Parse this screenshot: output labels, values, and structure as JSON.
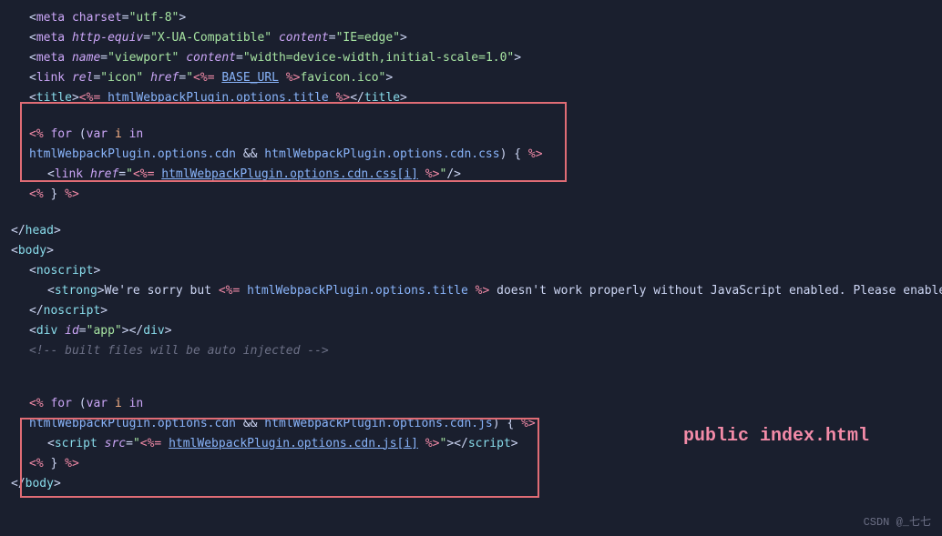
{
  "annotation": "public index.html",
  "watermark": "CSDN @_七七",
  "lines": [
    {
      "indent": 1,
      "content": "<code><span class='punct'>&lt;</span><span class='attr-name'>meta</span> <span class='attr-name'>charset</span><span class='punct'>=</span><span class='attr-val'>\"utf-8\"</span><span class='punct'>&gt;</span></code>"
    },
    {
      "indent": 1,
      "content": "<code><span class='punct'>&lt;</span><span class='attr-name'>meta</span> <span class='attr-name' style='font-style:italic'>http-equiv</span><span class='punct'>=</span><span class='attr-val'>\"X-UA-Compatible\"</span> <span class='attr-name' style='font-style:italic'>content</span><span class='punct'>=</span><span class='attr-val'>\"IE=edge\"</span><span class='punct'>&gt;</span></code>"
    },
    {
      "indent": 1,
      "content": "<code><span class='punct'>&lt;</span><span class='attr-name'>meta</span> <span class='attr-name' style='font-style:italic'>name</span><span class='punct'>=</span><span class='attr-val'>\"viewport\"</span> <span class='attr-name' style='font-style:italic'>content</span><span class='punct'>=</span><span class='attr-val'>\"width=device-width,initial-scale=1.0\"</span><span class='punct'>&gt;</span></code>"
    },
    {
      "indent": 1,
      "content": "<code><span class='punct'>&lt;</span><span class='attr-name'>link</span> <span class='attr-name' style='font-style:italic'>rel</span><span class='punct'>=</span><span class='attr-val'>\"icon\"</span> <span class='attr-name' style='font-style:italic'>href</span><span class='punct'>=</span><span class='attr-val'>\"</span><span class='tmpl-tag'>&lt;%=</span> <span class='url-link'>BASE_URL</span> <span class='tmpl-tag'>%&gt;</span><span class='attr-val'>favicon.ico\"</span><span class='punct'>&gt;</span></code>"
    },
    {
      "indent": 1,
      "content": "<code><span class='punct'>&lt;</span><span class='tag'>title</span><span class='punct'>&gt;</span><span class='tmpl-tag'>&lt;%=</span> <span class='tmpl-var'>htmlWebpackPlugin.options.title</span> <span class='tmpl-tag'>%&gt;</span><span class='punct'>&lt;/</span><span class='tag'>title</span><span class='punct'>&gt;</span></code>"
    },
    {
      "gap": true
    },
    {
      "indent": 1,
      "box": "css",
      "content": "<code><span class='tmpl-tag'>&lt;%</span> <span class='keyword'>for</span> <span class='white'>(</span><span class='keyword'>var</span> <span class='js-var'>i</span> <span class='keyword'>in</span></code>"
    },
    {
      "indent": 1,
      "box": "css",
      "content": "<code><span class='tmpl-var'>htmlWebpackPlugin.options.cdn</span> <span class='white'>&amp;&amp;</span> <span class='tmpl-var'>htmlWebpackPlugin.options.cdn.css</span><span class='white'>)</span> <span class='white'>{</span> <span class='tmpl-tag'>%&gt;</span></code>"
    },
    {
      "indent": 2,
      "box": "css",
      "content": "<code><span class='punct'>&lt;</span><span class='attr-name'>link</span> <span class='attr-name' style='font-style:italic'>href</span><span class='punct'>=</span><span class='attr-val'>\"</span><span class='tmpl-tag'>&lt;%=</span> <span class='url-link'>htmlWebpackPlugin.options.cdn.css[i]</span> <span class='tmpl-tag'>%&gt;</span><span class='attr-val'>\"</span><span class='punct'>/&gt;</span></code>"
    },
    {
      "indent": 1,
      "box": "css",
      "content": "<code><span class='tmpl-tag'>&lt;%</span> <span class='white'>}</span> <span class='tmpl-tag'>%&gt;</span></code>"
    },
    {
      "gap": true
    },
    {
      "indent": 0,
      "content": "<code><span class='punct'>&lt;/</span><span class='tag'>head</span><span class='punct'>&gt;</span></code>"
    },
    {
      "indent": 0,
      "content": "<code><span class='punct'>&lt;</span><span class='tag'>body</span><span class='punct'>&gt;</span></code>"
    },
    {
      "indent": 1,
      "content": "<code><span class='punct'>&lt;</span><span class='tag'>noscript</span><span class='punct'>&gt;</span></code>"
    },
    {
      "indent": 2,
      "content": "<code><span class='punct'>&lt;</span><span class='tag'>strong</span><span class='punct'>&gt;</span><span class='white'>We're sorry but</span> <span class='tmpl-tag'>&lt;%=</span> <span class='tmpl-var'>htmlWebpackPlugin.options.title</span> <span class='tmpl-tag'>%&gt;</span> <span class='white'>doesn't work properly without JavaScript enabled. Please enable it</span></code>"
    },
    {
      "indent": 1,
      "content": "<code><span class='punct'>&lt;/</span><span class='tag'>noscript</span><span class='punct'>&gt;</span></code>"
    },
    {
      "indent": 1,
      "content": "<code><span class='punct'>&lt;</span><span class='tag'>div</span> <span class='attr-name' style='font-style:italic'>id</span><span class='punct'>=</span><span class='attr-val'>\"app\"</span><span class='punct'>&gt;&lt;/</span><span class='tag'>div</span><span class='punct'>&gt;</span></code>"
    },
    {
      "indent": 1,
      "content": "<code><span class='comment'>&lt;!-- built files will be auto injected --&gt;</span></code>"
    },
    {
      "gap": true
    },
    {
      "gap": true
    },
    {
      "indent": 1,
      "box": "js",
      "content": "<code><span class='tmpl-tag'>&lt;%</span> <span class='keyword'>for</span> <span class='white'>(</span><span class='keyword'>var</span> <span class='js-var'>i</span> <span class='keyword'>in</span></code>"
    },
    {
      "indent": 1,
      "box": "js",
      "content": "<code><span class='tmpl-var'>htmlWebpackPlugin.options.cdn</span> <span class='white'>&amp;&amp;</span> <span class='tmpl-var'>htmlWebpackPlugin.options.cdn.js</span><span class='white'>)</span> <span class='white'>{</span> <span class='tmpl-tag'>%&gt;</span></code>"
    },
    {
      "indent": 2,
      "box": "js",
      "content": "<code><span class='punct'>&lt;</span><span class='tag'>script</span> <span class='attr-name' style='font-style:italic'>src</span><span class='punct'>=</span><span class='attr-val'>\"</span><span class='tmpl-tag'>&lt;%=</span> <span class='url-link'>htmlWebpackPlugin.options.cdn.js[i]</span> <span class='tmpl-tag'>%&gt;</span><span class='attr-val'>\"</span><span class='punct'>&gt;&lt;/</span><span class='tag'>script</span><span class='punct'>&gt;</span></code>"
    },
    {
      "indent": 1,
      "box": "js",
      "content": "<code><span class='tmpl-tag'>&lt;%</span> <span class='white'>}</span> <span class='tmpl-tag'>%&gt;</span></code>"
    },
    {
      "indent": 0,
      "content": "<code><span class='punct'>&lt;/</span><span class='tag'>body</span><span class='punct'>&gt;</span></code>"
    }
  ]
}
